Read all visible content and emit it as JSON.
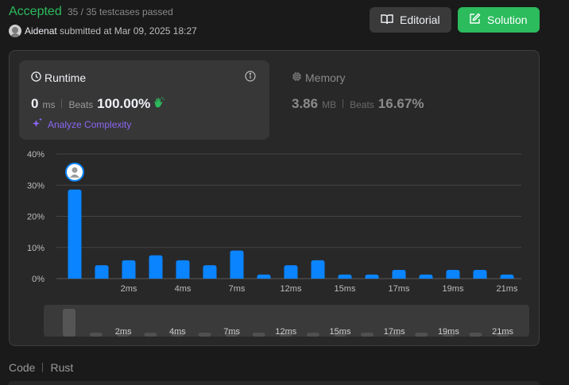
{
  "header": {
    "status": "Accepted",
    "testcases": "35 / 35 testcases passed",
    "user": "Aidenat",
    "submitted": "submitted at Mar 09, 2025 18:27",
    "editorial_label": "Editorial",
    "solution_label": "Solution"
  },
  "runtime": {
    "label": "Runtime",
    "value": "0",
    "unit": "ms",
    "beats_label": "Beats",
    "beats_value": "100.00%",
    "analyze_label": "Analyze Complexity"
  },
  "memory": {
    "label": "Memory",
    "value": "3.86",
    "unit": "MB",
    "beats_label": "Beats",
    "beats_value": "16.67%"
  },
  "bottom_tabs": {
    "code": "Code",
    "language": "Rust"
  },
  "colors": {
    "accepted": "#2cbb5d",
    "bar": "#0a84ff",
    "analyze": "#8b67f3"
  },
  "chart_data": {
    "type": "bar",
    "ylabel_ticks": [
      "0%",
      "10%",
      "20%",
      "30%",
      "40%"
    ],
    "ylim": [
      0,
      40
    ],
    "x_tick_labels": [
      "2ms",
      "4ms",
      "7ms",
      "12ms",
      "15ms",
      "17ms",
      "19ms",
      "21ms"
    ],
    "x_tick_bar_index": [
      2,
      4,
      6,
      8,
      10,
      12,
      14,
      16
    ],
    "values": [
      28.6,
      4.3,
      5.9,
      7.5,
      5.9,
      4.3,
      9.0,
      1.3,
      4.3,
      5.9,
      1.3,
      1.3,
      2.8,
      1.3,
      2.8,
      2.8,
      1.3
    ],
    "highlight_index": 0,
    "grid": true
  }
}
